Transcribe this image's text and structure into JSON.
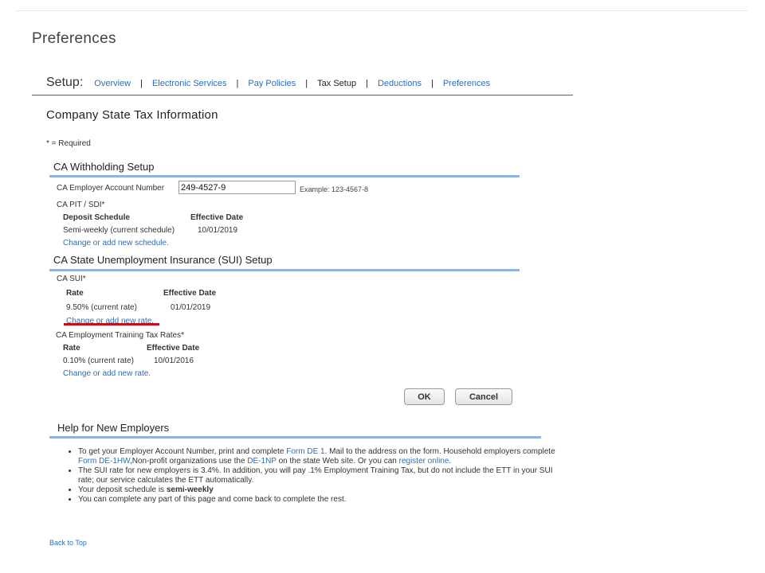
{
  "page": {
    "title": "Preferences"
  },
  "setup": {
    "label": "Setup:",
    "nav": [
      {
        "label": "Overview",
        "active": false
      },
      {
        "label": "Electronic Services",
        "active": false
      },
      {
        "label": "Pay Policies",
        "active": false
      },
      {
        "label": "Tax Setup",
        "active": true
      },
      {
        "label": "Deductions",
        "active": false
      },
      {
        "label": "Preferences",
        "active": false
      }
    ],
    "separator": "|"
  },
  "section": {
    "title": "Company State Tax Information",
    "required_note": "* = Required"
  },
  "withholding": {
    "heading": "CA Withholding Setup",
    "account_label": "CA Employer Account Number",
    "account_value": "249-4527-9",
    "account_example": "Example: 123-4567-8",
    "pit_label": "CA PIT / SDI*",
    "col_schedule": "Deposit Schedule",
    "col_effective": "Effective Date",
    "schedule_value": "Semi-weekly (current schedule)",
    "effective_value": "10/01/2019",
    "change_link": "Change or add new schedule."
  },
  "sui": {
    "heading": "CA State Unemployment Insurance (SUI) Setup",
    "label": "CA SUI*",
    "col_rate": "Rate",
    "col_effective": "Effective Date",
    "rate_value": "9.50% (current rate)",
    "effective_value": "01/01/2019",
    "change_link": "Change or add new rate."
  },
  "ett": {
    "label": "CA Employment Training Tax Rates*",
    "col_rate": "Rate",
    "col_effective": "Effective Date",
    "rate_value": "0.10% (current rate)",
    "effective_value": "10/01/2016",
    "change_link": "Change or add new rate."
  },
  "buttons": {
    "ok": "OK",
    "cancel": "Cancel"
  },
  "help": {
    "heading": "Help for New Employers",
    "b1_t1": "To get your Employer Account Number, print and complete ",
    "b1_link1": "Form DE 1",
    "b1_t2": ". Mail to the address on the form. Household employers complete ",
    "b1_link2": "Form DE-1HW",
    "b1_t3": ",Non-profit organizations use the ",
    "b1_link3": "DE-1NP",
    "b1_t4": " on the state Web site. Or you can ",
    "b1_link4": "register online",
    "b1_t5": ".",
    "b2": "The SUI rate for new employers is 3.4%. In addition, you will pay .1% Employment Training Tax, but do not include the ETT in your SUI rate; our service calculates the ETT automatically.",
    "b3_t1": "Your deposit schedule is ",
    "b3_bold": "semi-weekly",
    "b4": "You can complete any part of this page and come back to complete the rest."
  },
  "back_to_top": "Back to Top",
  "colors": {
    "link": "#2a6ebb",
    "rule": "#8fb3da",
    "highlight": "#c2101c"
  }
}
